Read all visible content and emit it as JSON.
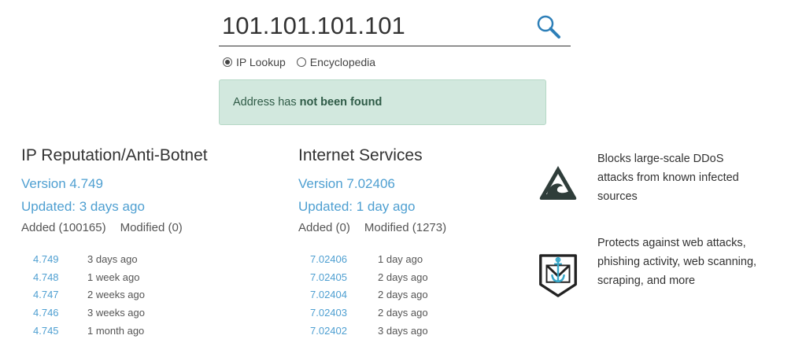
{
  "search": {
    "value": "101.101.101.101",
    "icon": "search-icon"
  },
  "search_mode": {
    "options": [
      {
        "label": "IP Lookup",
        "selected": true
      },
      {
        "label": "Encyclopedia",
        "selected": false
      }
    ]
  },
  "notice": {
    "prefix": "Address has",
    "emphasis": "not been found"
  },
  "ip_reputation": {
    "title": "IP Reputation/Anti-Botnet",
    "version": "Version 4.749",
    "updated": "Updated: 3 days ago",
    "added": "Added (100165)",
    "modified": "Modified (0)",
    "history": [
      {
        "version": "4.749",
        "age": "3 days ago"
      },
      {
        "version": "4.748",
        "age": "1 week ago"
      },
      {
        "version": "4.747",
        "age": "2 weeks ago"
      },
      {
        "version": "4.746",
        "age": "3 weeks ago"
      },
      {
        "version": "4.745",
        "age": "1 month ago"
      }
    ]
  },
  "internet_services": {
    "title": "Internet Services",
    "version": "Version 7.02406",
    "updated": "Updated: 1 day ago",
    "added": "Added (0)",
    "modified": "Modified (1273)",
    "history": [
      {
        "version": "7.02406",
        "age": "1 day ago"
      },
      {
        "version": "7.02405",
        "age": "2 days ago"
      },
      {
        "version": "7.02404",
        "age": "2 days ago"
      },
      {
        "version": "7.02403",
        "age": "2 days ago"
      },
      {
        "version": "7.02402",
        "age": "3 days ago"
      }
    ]
  },
  "features": [
    {
      "icon": "wave-warning-icon",
      "text": "Blocks large-scale DDoS attacks from known infected sources"
    },
    {
      "icon": "shield-anchor-mail-icon",
      "text": "Protects against web attacks, phishing activity, web scanning, scraping, and more"
    }
  ],
  "colors": {
    "link": "#4e9fd1",
    "notice_bg": "#d2e8de",
    "notice_text": "#2f5b47",
    "icon_dark": "#2f3d3a"
  }
}
